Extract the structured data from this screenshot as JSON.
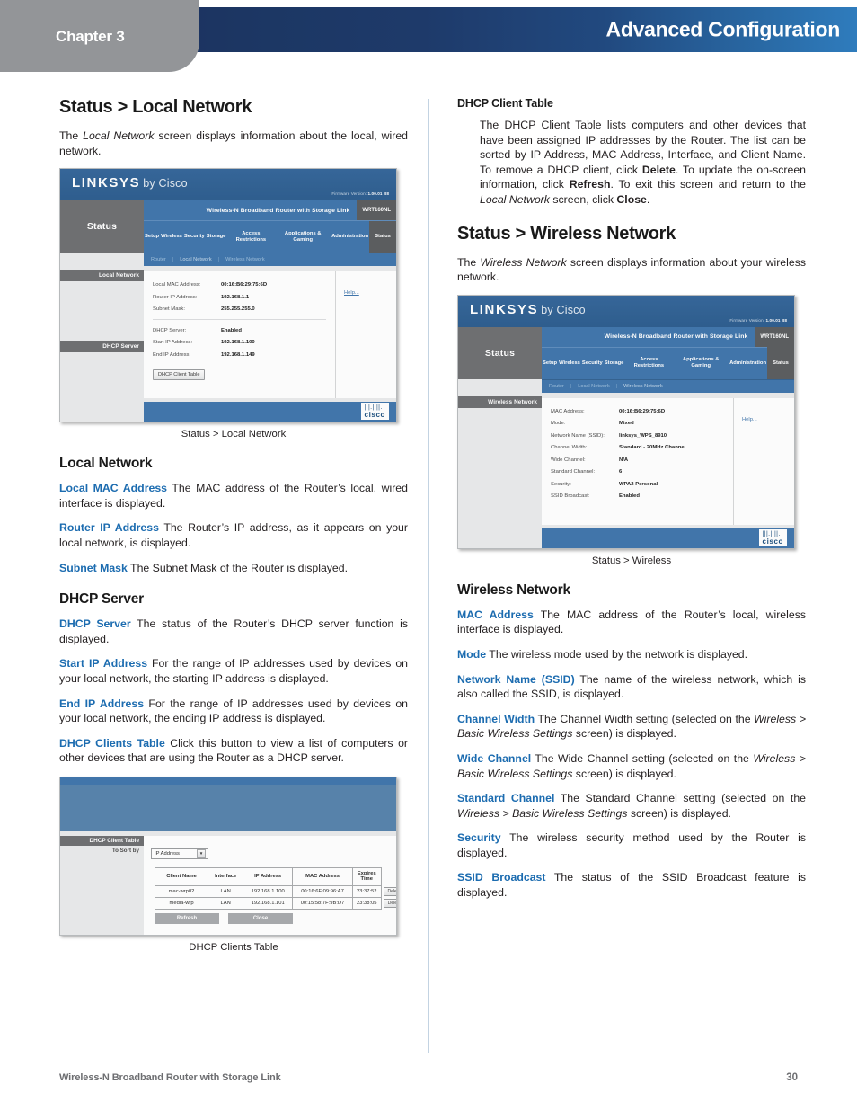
{
  "header": {
    "chapter": "Chapter 3",
    "title": "Advanced Configuration"
  },
  "footer": {
    "product": "Wireless-N Broadband Router with Storage Link",
    "page_number": "30"
  },
  "left_column": {
    "heading": "Status > Local Network",
    "intro_a": "The ",
    "intro_it": "Local Network",
    "intro_b": " screen displays information about the local, wired network.",
    "figure1_caption": "Status > Local Network",
    "local_network_heading": "Local Network",
    "terms_local": [
      {
        "term": "Local MAC Address",
        "desc": " The MAC address of the Router’s local, wired interface is displayed."
      },
      {
        "term": "Router IP Address",
        "desc": "  The Router’s IP address, as it appears on your local network, is displayed."
      },
      {
        "term": "Subnet Mask",
        "desc": " The Subnet Mask of the Router is displayed."
      }
    ],
    "dhcp_server_heading": "DHCP Server",
    "terms_dhcp": [
      {
        "term": "DHCP Server",
        "desc": " The status of the Router’s DHCP server function is displayed."
      },
      {
        "term": "Start IP Address",
        "desc": "  For the range of IP addresses used by devices on your local network, the starting IP address is displayed."
      },
      {
        "term": "End IP Address",
        "desc": "  For the range of IP addresses used by devices on your local network, the ending IP address is displayed."
      },
      {
        "term": "DHCP Clients Table",
        "desc": " Click this button to view a list of computers or other devices that are using the Router as a DHCP server."
      }
    ],
    "figure2_caption": "DHCP Clients Table"
  },
  "right_column": {
    "dhcp_client_table_heading": "DHCP Client Table",
    "dhcp_client_table_body": {
      "p1": "The DHCP Client Table lists computers and other devices that have been assigned IP addresses by the Router. The list can be sorted by IP Address, MAC Address, Interface, and Client Name. To remove a DHCP client, click ",
      "b1": "Delete",
      "p2": ". To update the on-screen information, click ",
      "b2": "Refresh",
      "p3": ". To exit this screen and return to the ",
      "i1": "Local Network",
      "p4": " screen, click ",
      "b3": "Close",
      "p5": "."
    },
    "heading": "Status > Wireless Network",
    "intro_a": "The ",
    "intro_it": "Wireless Network",
    "intro_b": " screen displays information about your wireless network.",
    "figure3_caption": "Status > Wireless",
    "wireless_network_heading": "Wireless Network",
    "terms_wireless": [
      {
        "term": "MAC Address",
        "desc": " The MAC address of the Router’s local, wireless interface is displayed."
      },
      {
        "term": "Mode",
        "desc": " The wireless mode used by the network is displayed."
      },
      {
        "term": "Network Name (SSID)",
        "desc": "  The name of the wireless network, which is also called the SSID, is displayed."
      }
    ],
    "terms_wireless_italic": [
      {
        "term": "Channel Width",
        "pre": "  The Channel Width setting (selected on the ",
        "it1": "Wireless",
        "mid": " > ",
        "it2": "Basic Wireless Settings",
        "post": " screen) is displayed."
      },
      {
        "term": "Wide Channel",
        "pre": " The Wide Channel setting (selected on the ",
        "it1": "Wireless",
        "mid": " > ",
        "it2": "Basic Wireless Settings",
        "post": " screen) is displayed."
      },
      {
        "term": "Standard Channel",
        "pre": " The Standard Channel setting (selected on the ",
        "it1": "Wireless",
        "mid": " > ",
        "it2": "Basic Wireless Settings",
        "post": " screen) is displayed."
      }
    ],
    "terms_wireless_tail": [
      {
        "term": "Security",
        "desc": "  The wireless security method used by the Router is displayed."
      },
      {
        "term": "SSID Broadcast",
        "desc": "  The status of the SSID Broadcast feature is displayed."
      }
    ]
  },
  "router_ui": {
    "brand": "LINKSYS",
    "brand_by": "by Cisco",
    "firmware_label": "Firmware Version:",
    "firmware_value": "1.00.01 B8",
    "model_name": "Wireless-N Broadband Router with Storage Link",
    "model_sku": "WRT160NL",
    "nav_tabs": [
      "Setup",
      "Wireless",
      "Security",
      "Storage",
      "Access Restrictions",
      "Applications & Gaming",
      "Administration"
    ],
    "nav_active": "Status",
    "section_label": "Status",
    "help_link": "Help...",
    "cisco_word": "cisco",
    "local": {
      "breadcrumbs": [
        "Router",
        "Local Network",
        "Wireless Network"
      ],
      "breadcrumb_active": "Local Network",
      "panel1_label": "Local Network",
      "panel2_label": "DHCP Server",
      "rows1": [
        {
          "k": "Local MAC Address:",
          "v": "00:16:B6:29:75:6D"
        },
        {
          "k": "Router IP Address:",
          "v": "192.168.1.1"
        },
        {
          "k": "Subnet Mask:",
          "v": "255.255.255.0"
        }
      ],
      "rows2": [
        {
          "k": "DHCP Server:",
          "v": "Enabled"
        },
        {
          "k": "Start IP Address:",
          "v": "192.168.1.100"
        },
        {
          "k": "End IP Address:",
          "v": "192.168.1.149"
        }
      ],
      "button": "DHCP Client Table"
    },
    "wireless": {
      "breadcrumbs": [
        "Router",
        "Local Network",
        "Wireless Network"
      ],
      "breadcrumb_active": "Wireless Network",
      "panel_label": "Wireless Network",
      "rows": [
        {
          "k": "MAC Address:",
          "v": "00:16:B6:29:75:6D"
        },
        {
          "k": "Mode:",
          "v": "Mixed"
        },
        {
          "k": "Network Name (SSID):",
          "v": "linksys_WPS_8910"
        },
        {
          "k": "Channel Width:",
          "v": "Standard - 20MHz Channel"
        },
        {
          "k": "Wide Channel:",
          "v": "N/A"
        },
        {
          "k": "Standard Channel:",
          "v": "6"
        },
        {
          "k": "Security:",
          "v": "WPA2 Personal"
        },
        {
          "k": "SSID Broadcast:",
          "v": "Enabled"
        }
      ]
    }
  },
  "dhcp_table_ui": {
    "panel_label": "DHCP Client Table",
    "sort_label": "To Sort by",
    "sort_value": "IP Address",
    "columns": [
      "Client Name",
      "Interface",
      "IP Address",
      "MAC Address",
      "Expires Time",
      ""
    ],
    "rows": [
      {
        "client_name": "mac-wrp02",
        "interface": "LAN",
        "ip_address": "192.168.1.100",
        "mac_address": "00:16:6F:09:96:A7",
        "expires_time": "23:37:52",
        "action": "Delete"
      },
      {
        "client_name": "media-wrp",
        "interface": "LAN",
        "ip_address": "192.168.1.101",
        "mac_address": "00:15:58:7F:9B:D7",
        "expires_time": "23:38:05",
        "action": "Delete"
      }
    ],
    "buttons": [
      "Refresh",
      "Close"
    ]
  }
}
